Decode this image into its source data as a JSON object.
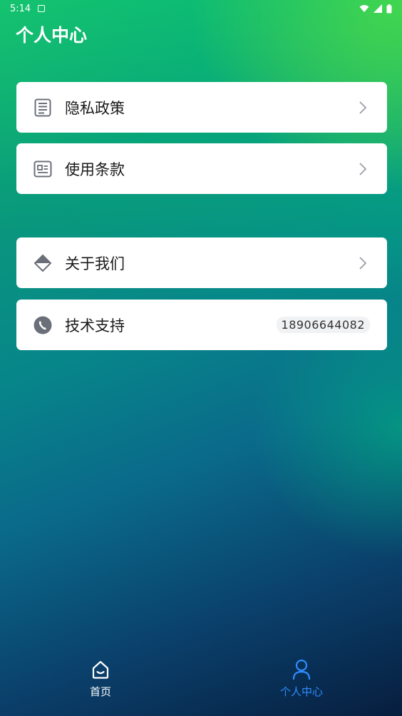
{
  "status_bar": {
    "time": "5:14"
  },
  "page": {
    "title": "个人中心"
  },
  "menu": {
    "privacy": {
      "label": "隐私政策",
      "icon": "document-list-icon"
    },
    "terms": {
      "label": "使用条款",
      "icon": "id-card-icon"
    },
    "about": {
      "label": "关于我们",
      "icon": "diamond-icon"
    },
    "support": {
      "label": "技术支持",
      "icon": "phone-icon",
      "phone": "18906644082"
    }
  },
  "tabs": {
    "home": {
      "label": "首页",
      "icon": "home-icon"
    },
    "profile": {
      "label": "个人中心",
      "icon": "user-icon",
      "active": true
    }
  },
  "colors": {
    "active_tab": "#2f8cff",
    "card_bg": "#ffffff",
    "icon_gray": "#6b6f7a"
  }
}
